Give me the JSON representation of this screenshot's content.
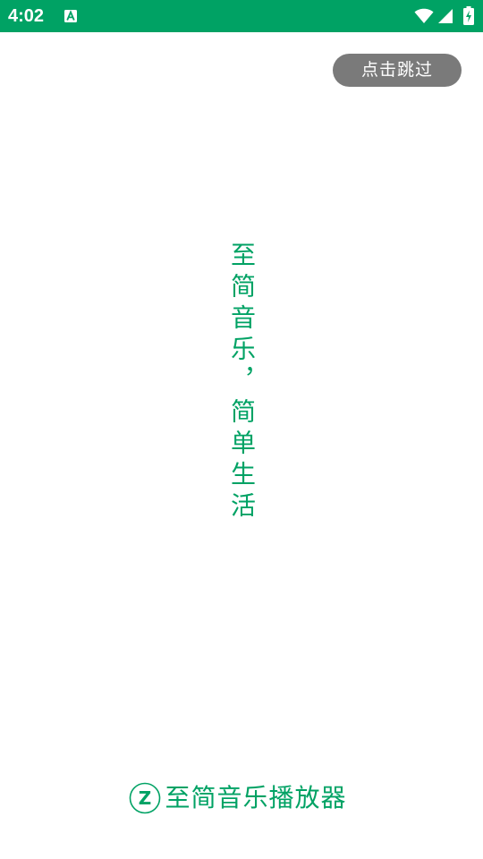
{
  "status_bar": {
    "time": "4:02",
    "notification_icon": "accessibility-a-icon",
    "wifi_icon": "wifi-icon",
    "signal_icon": "cell-signal-icon",
    "battery_icon": "battery-charging-icon",
    "background_color": "#00a264"
  },
  "splash": {
    "skip_label": "点击跳过",
    "slogan": "至简音乐，简单生活",
    "brand_name": "至简音乐播放器",
    "brand_logo_letter": "Z",
    "accent_color": "#00a264",
    "skip_button_color": "#7a7a7a"
  }
}
